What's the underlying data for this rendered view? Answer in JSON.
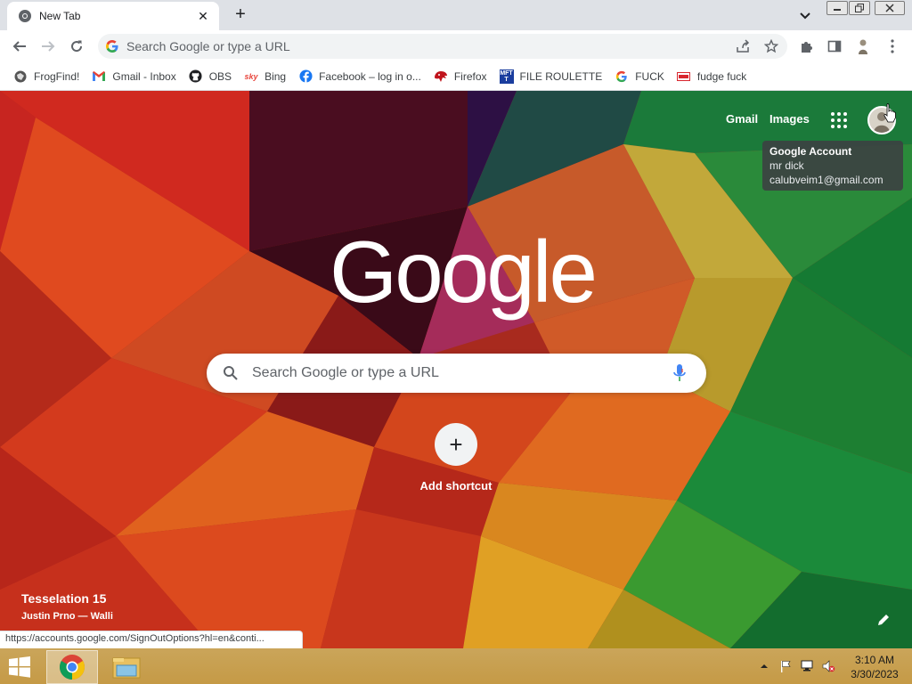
{
  "tab": {
    "title": "New Tab",
    "close": "✕"
  },
  "newtab": "+",
  "omnibox": {
    "placeholder": "Search Google or type a URL"
  },
  "bookmarks": [
    {
      "label": "FrogFind!",
      "icon": "frogfind-icon"
    },
    {
      "label": "Gmail - Inbox",
      "icon": "gmail-icon"
    },
    {
      "label": "OBS",
      "icon": "github-icon"
    },
    {
      "label": "Bing",
      "icon": "bing-icon"
    },
    {
      "label": "Facebook – log in o...",
      "icon": "facebook-icon"
    },
    {
      "label": "Firefox",
      "icon": "firefox-icon"
    },
    {
      "label": "FILE ROULETTE",
      "icon": "mft-icon"
    },
    {
      "label": "FUCK",
      "icon": "google-icon"
    },
    {
      "label": "fudge fuck",
      "icon": "site-icon"
    }
  ],
  "ntp": {
    "gmail": "Gmail",
    "images": "Images",
    "logo": "Google",
    "search_placeholder": "Search Google or type a URL",
    "add_shortcut": "Add shortcut",
    "plus": "+",
    "background_title": "Tesselation 15",
    "background_author": "Justin Prno — Walli",
    "status_url": "https://accounts.google.com/SignOutOptions?hl=en&conti..."
  },
  "tooltip": {
    "title": "Google Account",
    "name": "mr dick",
    "email": "calubveim1@gmail.com"
  },
  "clock": {
    "time": "3:10 AM",
    "date": "3/30/2023"
  },
  "colors": {
    "chrome_bg": "#dee1e6",
    "taskbar": "#c59a46",
    "accent": "#1a73e8"
  }
}
